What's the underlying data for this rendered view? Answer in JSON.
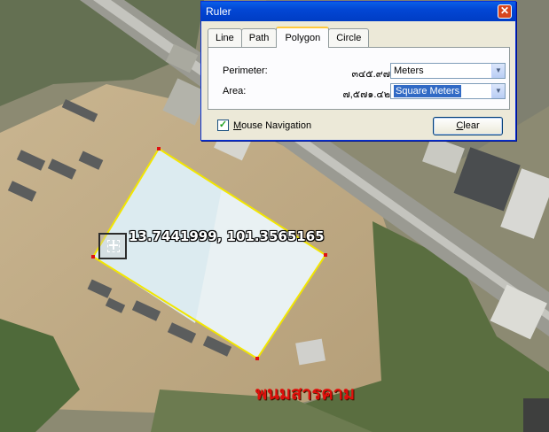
{
  "map": {
    "coordinates": "13.7441999, 101.3565165",
    "place_name": "พนมสารคาม",
    "polygon_color": "#f2e600",
    "vertex_color": "#e01010"
  },
  "ruler": {
    "title": "Ruler",
    "close_glyph": "✕",
    "tabs": [
      {
        "label": "Line",
        "active": false
      },
      {
        "label": "Path",
        "active": false
      },
      {
        "label": "Polygon",
        "active": true
      },
      {
        "label": "Circle",
        "active": false
      }
    ],
    "perimeter": {
      "label": "Perimeter:",
      "value": "๓๔๕.๙๗",
      "unit": "Meters"
    },
    "area": {
      "label": "Area:",
      "value": "๗,๕๗๑.๔๒",
      "unit": "Square Meters"
    },
    "mouse_navigation": {
      "label": "Mouse Navigation",
      "checked": true
    },
    "clear_label": "Clear"
  }
}
